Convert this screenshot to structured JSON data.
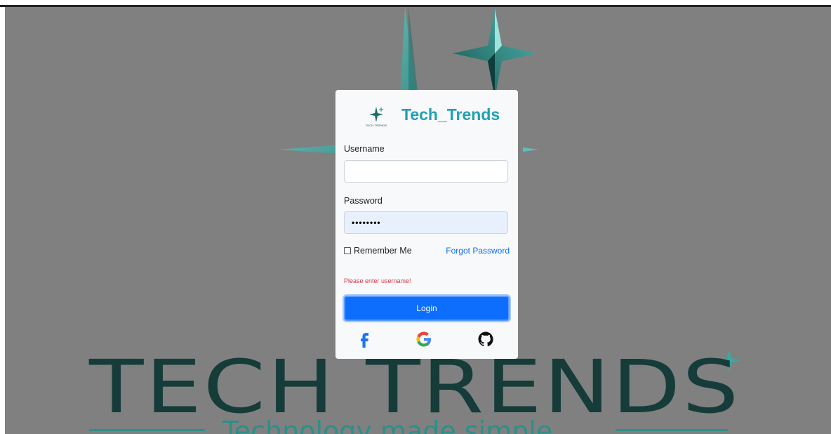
{
  "background": {
    "brand_wordmark": "TECH TRENDS",
    "tagline": "Technology made simple"
  },
  "login": {
    "logo_caption": "TECH TRENDS",
    "title": "Tech_Trends",
    "username_label": "Username",
    "username_value": "",
    "password_label": "Password",
    "password_value": "••••••••",
    "remember_label": "Remember Me",
    "forgot_label": "Forgot Password",
    "error_message": "Please enter username!",
    "login_label": "Login",
    "social": [
      "facebook-icon",
      "google-icon",
      "github-icon"
    ]
  },
  "colors": {
    "accent": "#20a0b4",
    "primary": "#0d6efd",
    "error": "#dc3545",
    "backdrop": "#808080",
    "brand_dark": "#163c3a"
  }
}
